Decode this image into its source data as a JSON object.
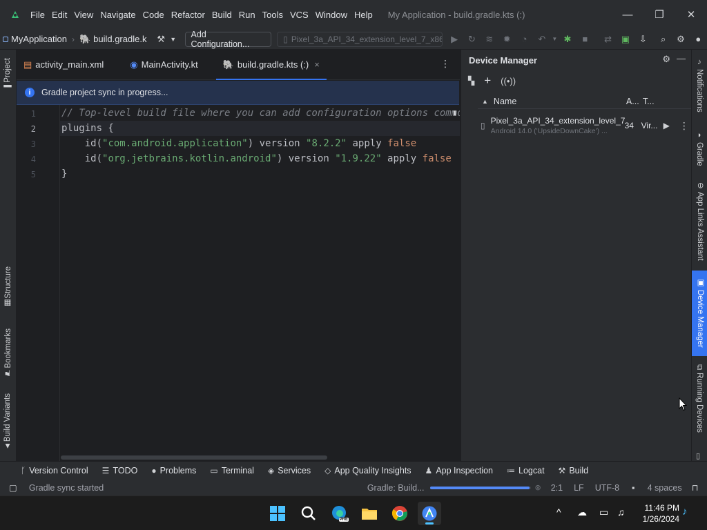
{
  "window": {
    "menu": [
      "File",
      "Edit",
      "View",
      "Navigate",
      "Code",
      "Refactor",
      "Build",
      "Run",
      "Tools",
      "VCS",
      "Window",
      "Help"
    ],
    "title": "My Application - build.gradle.kts (:)",
    "minimize": "—",
    "maximize": "❐",
    "close": "✕"
  },
  "toolbar": {
    "project": "MyApplication",
    "file_crumb": "build.gradle.k",
    "add_config": "Add Configuration...",
    "device": "Pixel_3a_API_34_extension_level_7_x86_..."
  },
  "left_stripe": {
    "project": "Project",
    "structure": "Structure",
    "bookmarks": "Bookmarks",
    "build_variants": "Build Variants"
  },
  "editor": {
    "tabs": [
      {
        "label": "activity_main.xml"
      },
      {
        "label": "MainActivity.kt"
      },
      {
        "label": "build.gradle.kts (:)",
        "close": "×"
      }
    ],
    "banner": "Gradle project sync in progress...",
    "line_numbers": [
      "1",
      "2",
      "3",
      "4",
      "5"
    ],
    "code": {
      "l1": "// Top-level build file where you can add configuration options common",
      "l2": "plugins {",
      "l3_a": "    id(",
      "l3_b": "\"com.android.application\"",
      "l3_c": ") version ",
      "l3_d": "\"8.2.2\"",
      "l3_e": " apply ",
      "l3_f": "false",
      "l4_a": "    id(",
      "l4_b": "\"org.jetbrains.kotlin.android\"",
      "l4_c": ") version ",
      "l4_d": "\"1.9.22\"",
      "l4_e": " apply ",
      "l4_f": "false",
      "l5": "}"
    }
  },
  "device_manager": {
    "title": "Device Manager",
    "columns": {
      "name": "Name",
      "api": "A...",
      "type": "T..."
    },
    "device": {
      "name": "Pixel_3a_API_34_extension_level_7...",
      "subtitle": "Android 14.0 ('UpsideDownCake') ...",
      "api": "34",
      "type": "Vir..."
    }
  },
  "right_stripe": {
    "notifications": "Notifications",
    "gradle": "Gradle",
    "app_links": "App Links Assistant",
    "device_manager": "Device Manager",
    "running_devices": "Running Devices"
  },
  "bottom_tools": [
    "Version Control",
    "TODO",
    "Problems",
    "Terminal",
    "Services",
    "App Quality Insights",
    "App Inspection",
    "Logcat",
    "Build"
  ],
  "status": {
    "message": "Gradle sync started",
    "task": "Gradle: Build...",
    "progress": 0.99,
    "position": "2:1",
    "line_sep": "LF",
    "encoding": "UTF-8",
    "indent": "4 spaces"
  },
  "taskbar": {
    "time": "11:46 PM",
    "date": "1/26/2024",
    "edge_badge": "PRE"
  },
  "colors": {
    "accent": "#3574f0",
    "banner_bg": "#25324d",
    "string": "#6aab73",
    "keyword": "#cf8e6d",
    "comment": "#7a7e85"
  }
}
